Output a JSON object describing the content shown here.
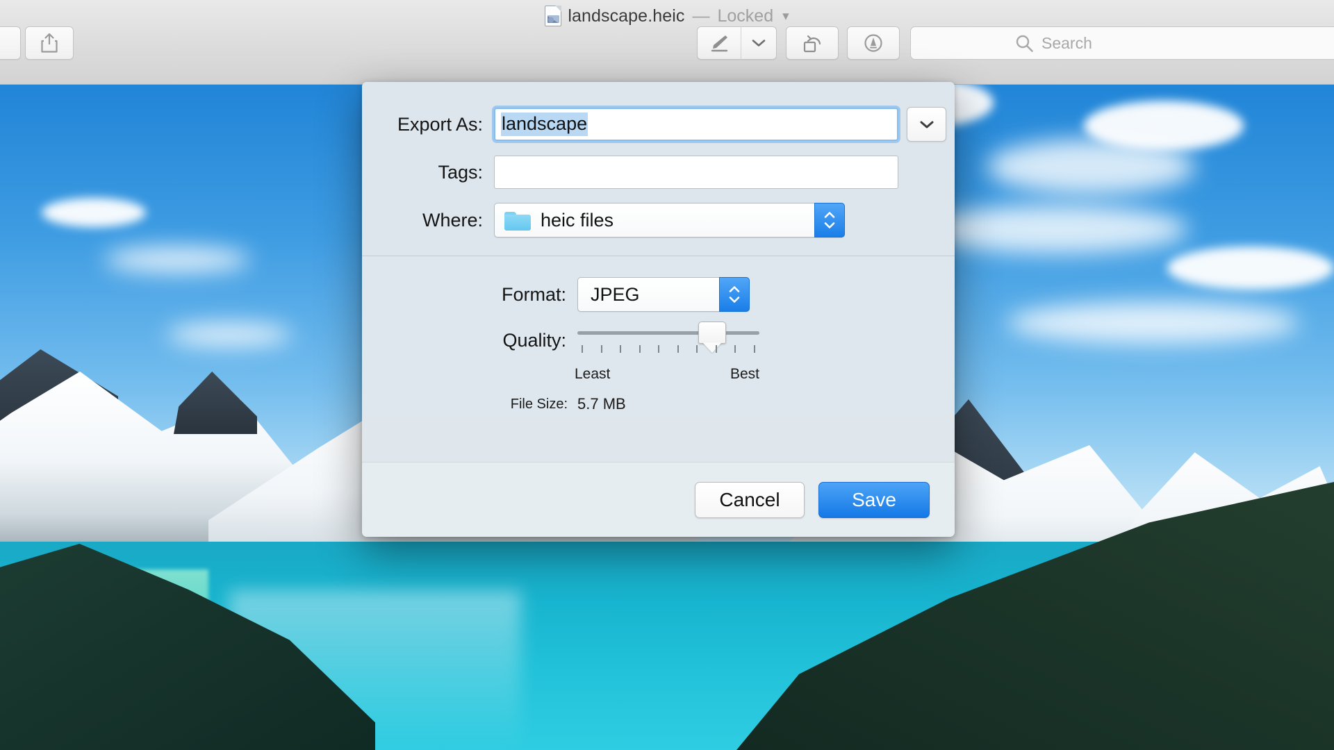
{
  "window": {
    "title_filename": "landscape.heic",
    "title_separator": "—",
    "title_state": "Locked",
    "title_chevron_icon": "chevron-down-icon",
    "doc_icon": "image-document-icon"
  },
  "toolbar": {
    "share_icon": "share-icon",
    "markup_icon": "markup-pen-icon",
    "markup_menu_icon": "chevron-down-icon",
    "rotate_icon": "rotate-left-icon",
    "annotate_icon": "annotate-circle-icon",
    "search": {
      "icon": "search-icon",
      "placeholder": "Search",
      "value": ""
    }
  },
  "export_sheet": {
    "export_as": {
      "label": "Export As:",
      "value": "landscape",
      "selected": true,
      "expand_icon": "chevron-down-icon"
    },
    "tags": {
      "label": "Tags:",
      "value": "",
      "placeholder": ""
    },
    "where": {
      "label": "Where:",
      "value": "heic files",
      "folder_icon": "folder-icon",
      "stepper_icon": "stepper-up-down-icon"
    },
    "format": {
      "label": "Format:",
      "value": "JPEG",
      "stepper_icon": "stepper-up-down-icon"
    },
    "quality": {
      "label": "Quality:",
      "least_label": "Least",
      "best_label": "Best",
      "value_percent": 74,
      "tick_count": 10
    },
    "file_size": {
      "label": "File Size:",
      "value": "5.7 MB"
    },
    "buttons": {
      "cancel": "Cancel",
      "save": "Save"
    }
  },
  "colors": {
    "accent_blue": "#1478e6",
    "focus_ring": "#86bdef",
    "selection": "#b8d8f4",
    "sheet_bg": "#dde6ed",
    "folder_blue": "#63c7ef"
  }
}
